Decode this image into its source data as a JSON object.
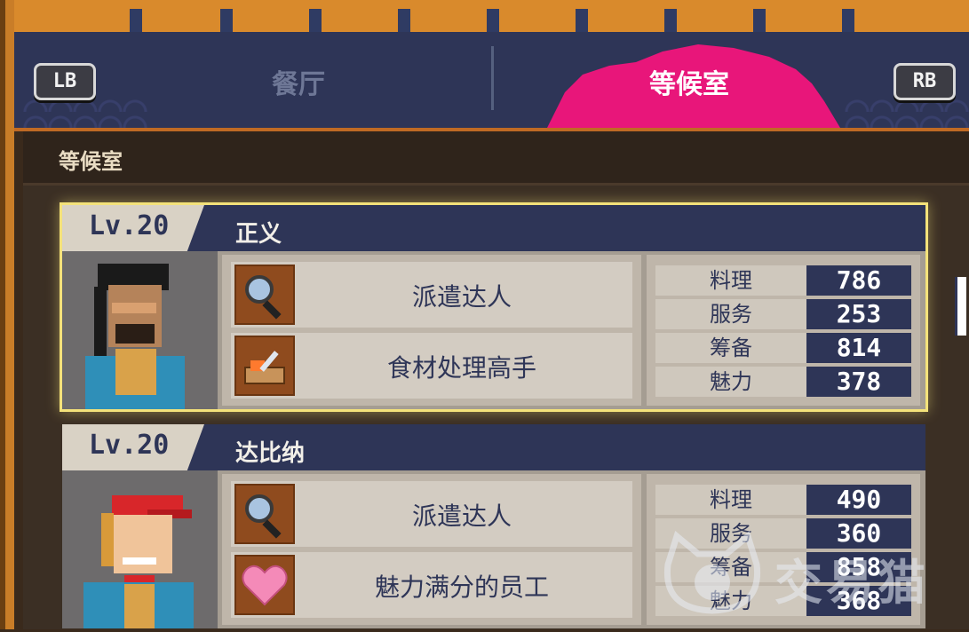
{
  "controls": {
    "left_shoulder": "LB",
    "right_shoulder": "RB"
  },
  "tabs": [
    {
      "label": "餐厅",
      "active": false
    },
    {
      "label": "等候室",
      "active": true
    }
  ],
  "section_title": "等候室",
  "staff": [
    {
      "level": "Lv.20",
      "name": "正义",
      "selected": true,
      "skills": [
        {
          "icon": "magnifier-icon",
          "label": "派遣达人"
        },
        {
          "icon": "cutting-board-icon",
          "label": "食材处理高手"
        }
      ],
      "stats": [
        {
          "label": "料理",
          "value": "786"
        },
        {
          "label": "服务",
          "value": "253"
        },
        {
          "label": "筹备",
          "value": "814"
        },
        {
          "label": "魅力",
          "value": "378"
        }
      ]
    },
    {
      "level": "Lv.20",
      "name": "达比纳",
      "selected": false,
      "skills": [
        {
          "icon": "magnifier-icon",
          "label": "派遣达人"
        },
        {
          "icon": "heart-icon",
          "label": "魅力满分的员工"
        }
      ],
      "stats": [
        {
          "label": "料理",
          "value": "490"
        },
        {
          "label": "服务",
          "value": "360"
        },
        {
          "label": "筹备",
          "value": "858"
        },
        {
          "label": "魅力",
          "value": "368"
        }
      ]
    }
  ],
  "watermark": {
    "text": "交易猫"
  },
  "colors": {
    "active_tab_brush": "#e8167a",
    "panel_navy": "#2e3557",
    "selection_glow": "#f4e27a"
  }
}
